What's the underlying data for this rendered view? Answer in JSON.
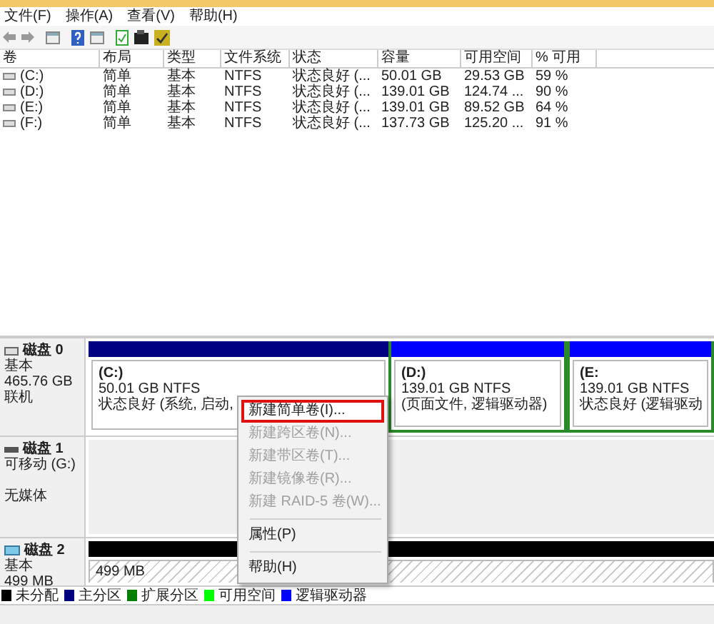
{
  "menu_bar": [
    "文件(F)",
    "操作(A)",
    "查看(V)",
    "帮助(H)"
  ],
  "table": {
    "columns": [
      "卷",
      "布局",
      "类型",
      "文件系统",
      "状态",
      "容量",
      "可用空间",
      "% 可用"
    ],
    "rows": [
      [
        "(C:)",
        "简单",
        "基本",
        "NTFS",
        "状态良好 (...",
        "50.01 GB",
        "29.53 GB",
        "59 %"
      ],
      [
        "(D:)",
        "简单",
        "基本",
        "NTFS",
        "状态良好 (...",
        "139.01 GB",
        "124.74 ...",
        "90 %"
      ],
      [
        "(E:)",
        "简单",
        "基本",
        "NTFS",
        "状态良好 (...",
        "139.01 GB",
        "89.52 GB",
        "64 %"
      ],
      [
        "(F:)",
        "简单",
        "基本",
        "NTFS",
        "状态良好 (...",
        "137.73 GB",
        "125.20 ...",
        "91 %"
      ]
    ]
  },
  "disks": [
    {
      "name": "磁盘 0",
      "kind": "basic",
      "lines": [
        "基本",
        "465.76 GB",
        "联机"
      ],
      "partitions": [
        {
          "kind": "primary",
          "label": "(C:)",
          "size": "50.01 GB NTFS",
          "status": "状态良好 (系统, 启动,"
        },
        {
          "kind": "logical",
          "label": "(D:)",
          "size": "139.01 GB NTFS",
          "status": "(页面文件, 逻辑驱动器)"
        },
        {
          "kind": "logical",
          "label": "(E:",
          "size": "139.01 GB NTFS",
          "status": "状态良好 (逻辑驱动"
        }
      ]
    },
    {
      "name": "磁盘 1",
      "kind": "removable",
      "lines": [
        "可移动 (G:)",
        "无媒体"
      ]
    },
    {
      "name": "磁盘 2",
      "kind": "usb",
      "lines": [
        "基本",
        "499 MB"
      ],
      "partitions": [
        {
          "kind": "unallocated",
          "size": "499 MB"
        }
      ]
    }
  ],
  "context_menu": [
    {
      "label": "新建简单卷(I)...",
      "disabled": false,
      "selected": true
    },
    {
      "label": "新建跨区卷(N)...",
      "disabled": true,
      "selected": false
    },
    {
      "label": "新建带区卷(T)...",
      "disabled": true,
      "selected": false
    },
    {
      "label": "新建镜像卷(R)...",
      "disabled": true,
      "selected": false
    },
    {
      "label": "新建 RAID-5 卷(W)...",
      "disabled": true,
      "selected": false
    },
    {
      "kind": "separator"
    },
    {
      "label": "属性(P)",
      "disabled": false,
      "selected": false
    },
    {
      "kind": "separator"
    },
    {
      "label": "帮助(H)",
      "disabled": false,
      "selected": false
    }
  ],
  "legend": [
    {
      "label": "未分配",
      "color": "#000000"
    },
    {
      "label": "主分区",
      "color": "#000080"
    },
    {
      "label": "扩展分区",
      "color": "#008000"
    },
    {
      "label": "可用空间",
      "color": "#00ff00"
    },
    {
      "label": "逻辑驱动器",
      "color": "#0000ff"
    }
  ]
}
